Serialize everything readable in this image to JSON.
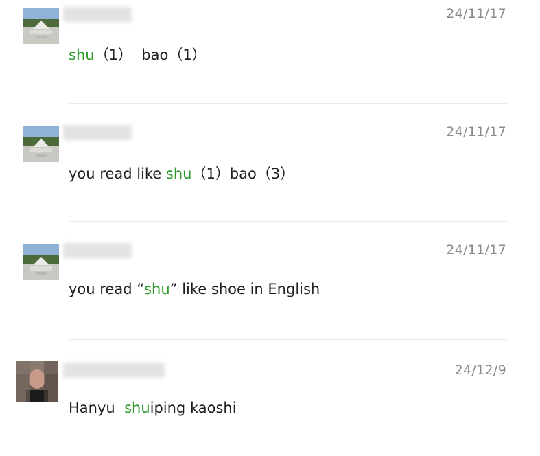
{
  "comments": [
    {
      "date": "24/11/17",
      "parts": {
        "hl": "shu",
        "after": "（1）  bao（1）"
      },
      "avatar_icon": "landscape-avatar-icon"
    },
    {
      "date": "24/11/17",
      "parts": {
        "before": "you read like ",
        "hl": "shu",
        "after": "（1）bao（3）"
      },
      "avatar_icon": "landscape-avatar-icon"
    },
    {
      "date": "24/11/17",
      "parts": {
        "before": "you read “",
        "hl": "shu",
        "after": "” like shoe in English"
      },
      "avatar_icon": "landscape-avatar-icon"
    },
    {
      "date": "24/12/9",
      "parts": {
        "before": "Hanyu  ",
        "hl": "shu",
        "after": "iping kaoshi"
      },
      "avatar_icon": "person-avatar-icon"
    }
  ],
  "colors": {
    "highlight": "#2a9a2a",
    "date": "#8a8a8a",
    "text": "#1f1f1f"
  }
}
